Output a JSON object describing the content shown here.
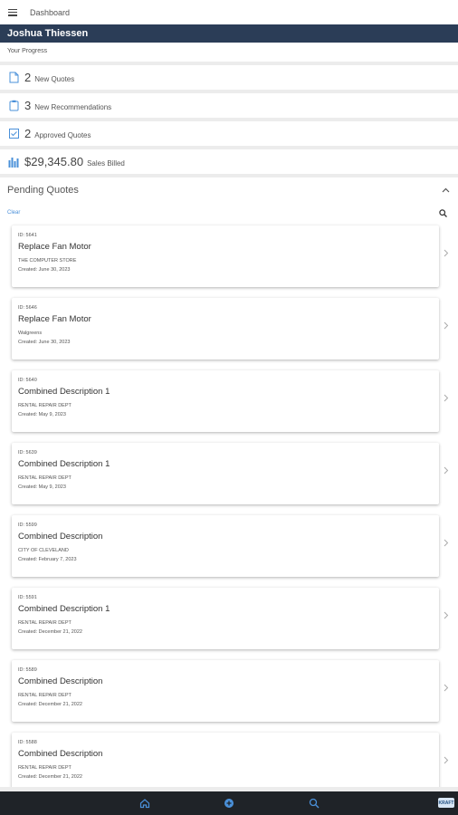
{
  "header": {
    "title": "Dashboard"
  },
  "user": {
    "name": "Joshua Thiessen"
  },
  "progress": {
    "label": "Your Progress",
    "stats": [
      {
        "icon": "document-icon",
        "count": "2",
        "label": "New Quotes"
      },
      {
        "icon": "clipboard-icon",
        "count": "3",
        "label": "New Recommendations"
      },
      {
        "icon": "checkbox-icon",
        "count": "2",
        "label": "Approved Quotes"
      },
      {
        "icon": "bar-chart-icon",
        "count": "$29,345.80",
        "label": "Sales Billed"
      }
    ]
  },
  "pending": {
    "title": "Pending Quotes",
    "filter_label": "Clear",
    "quotes": [
      {
        "id": "ID: 5641",
        "title": "Replace Fan Motor",
        "customer": "THE COMPUTER STORE",
        "created": "Created: June 30, 2023"
      },
      {
        "id": "ID: 5646",
        "title": "Replace Fan Motor",
        "customer": "Walgreens",
        "created": "Created: June 30, 2023"
      },
      {
        "id": "ID: 5640",
        "title": "Combined Description 1",
        "customer": "RENTAL REPAIR DEPT",
        "created": "Created: May 9, 2023"
      },
      {
        "id": "ID: 5639",
        "title": "Combined Description 1",
        "customer": "RENTAL REPAIR DEPT",
        "created": "Created: May 9, 2023"
      },
      {
        "id": "ID: 5599",
        "title": "Combined Description",
        "customer": "CITY OF CLEVELAND",
        "created": "Created: February 7, 2023"
      },
      {
        "id": "ID: 5591",
        "title": "Combined Description 1",
        "customer": "RENTAL REPAIR DEPT",
        "created": "Created: December 21, 2022"
      },
      {
        "id": "ID: 5589",
        "title": "Combined Description",
        "customer": "RENTAL REPAIR DEPT",
        "created": "Created: December 21, 2022"
      },
      {
        "id": "ID: 5588",
        "title": "Combined Description",
        "customer": "RENTAL REPAIR DEPT",
        "created": "Created: December 21, 2022"
      }
    ]
  },
  "bottom_nav": {
    "items": [
      {
        "icon": "home-icon"
      },
      {
        "icon": "add-circle-icon"
      },
      {
        "icon": "search-icon"
      }
    ],
    "badge": "KRAFT"
  },
  "colors": {
    "header_bg": "#2b3d57",
    "accent": "#4a90d9",
    "bottom_bar": "#1f2328"
  }
}
